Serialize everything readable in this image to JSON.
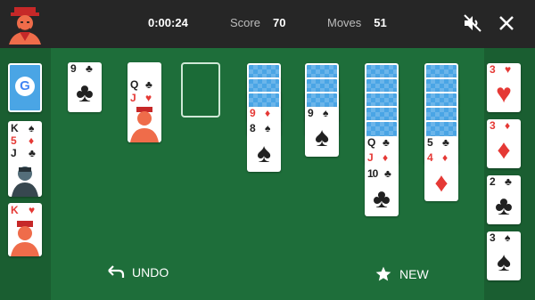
{
  "header": {
    "timer": "0:00:24",
    "score_label": "Score",
    "score_value": "70",
    "moves_label": "Moves",
    "moves_value": "51"
  },
  "icons": {
    "avatar": "jack-avatar-icon",
    "mute": "muted-speaker-icon",
    "close": "close-icon",
    "stock": "google-logo-icon",
    "undo": "undo-icon",
    "new": "star-icon"
  },
  "colors": {
    "felt": "#1e6e3a",
    "side": "#1a5e31",
    "topbar": "#262626",
    "card_back": "#4aa5e5",
    "red_suit": "#e53935",
    "black_suit": "#212121"
  },
  "suits": {
    "spade": "♠",
    "heart": "♥",
    "diamond": "♦",
    "club": "♣"
  },
  "left_column": {
    "stock_label": "G",
    "stack1": [
      "K",
      "5",
      "J"
    ],
    "stack2": [
      "K"
    ]
  },
  "waste": {
    "rank": "9"
  },
  "pile2": {
    "ranks": [
      "Q",
      "J"
    ]
  },
  "tableau": {
    "col4": [
      "9",
      "8"
    ],
    "col5": [
      "9"
    ],
    "col6": [
      "Q",
      "J",
      "10"
    ],
    "col7": [
      "5",
      "4"
    ]
  },
  "foundations": [
    {
      "rank": "3",
      "suit": "heart"
    },
    {
      "rank": "3",
      "suit": "diamond"
    },
    {
      "rank": "2",
      "suit": "club"
    },
    {
      "rank": "3",
      "suit": "spade"
    }
  ],
  "buttons": {
    "undo_label": "UNDO",
    "new_label": "NEW"
  }
}
